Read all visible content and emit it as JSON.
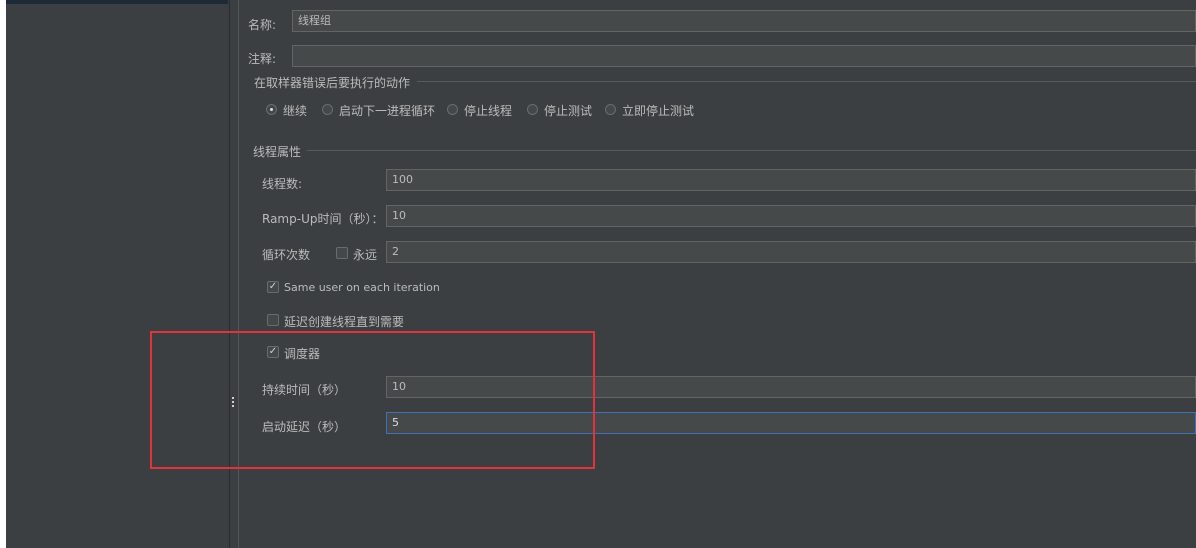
{
  "name_label": "名称:",
  "name_value": "线程组",
  "comment_label": "注释:",
  "comment_value": "",
  "error_action": {
    "title": "在取样器错误后要执行的动作",
    "options": [
      "继续",
      "启动下一进程循环",
      "停止线程",
      "停止测试",
      "立即停止测试"
    ],
    "selected": 0
  },
  "thread_props": {
    "title": "线程属性",
    "threads_label": "线程数:",
    "threads_value": "100",
    "rampup_label": "Ramp-Up时间（秒）：",
    "rampup_value": "10",
    "loop_label": "循环次数",
    "forever_label": "永远",
    "forever_checked": false,
    "loop_value": "2",
    "same_user_label": "Same user on each iteration",
    "same_user_checked": true,
    "delay_create_label": "延迟创建线程直到需要",
    "delay_create_checked": false,
    "scheduler_label": "调度器",
    "scheduler_checked": true,
    "duration_label": "持续时间（秒）",
    "duration_value": "10",
    "startup_delay_label": "启动延迟（秒）",
    "startup_delay_value": "5"
  },
  "colors": {
    "background": "#3c3f41",
    "field_bg": "#45494a",
    "focus_border": "#3f72b4",
    "highlight": "#e2333b"
  },
  "icons": {
    "checkmark": "✓"
  }
}
